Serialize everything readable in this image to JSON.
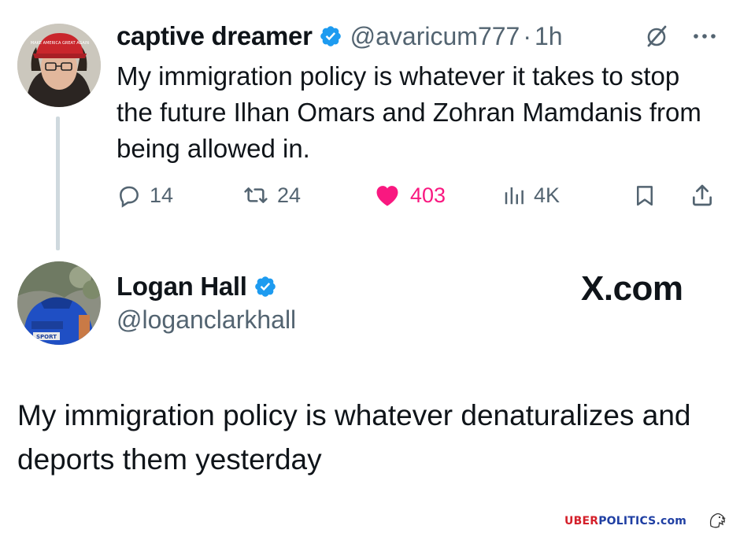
{
  "tweet1": {
    "name": "captive dreamer",
    "handle": "@avaricum777",
    "separator": "·",
    "time": "1h",
    "text": "My immigration policy is whatever it takes to stop the future Ilhan Omars and Zohran Mamdanis from being allowed in.",
    "replies": "14",
    "retweets": "24",
    "likes": "403",
    "views": "4K",
    "avatar_hat_text": "MAKE AMERICA GREAT AGAIN"
  },
  "tweet2": {
    "name": "Logan Hall",
    "handle": "@loganclarkhall",
    "text": "My immigration policy is whatever denaturalizes and deports them yesterday",
    "avatar_jacket_text": "SPORT"
  },
  "brand": {
    "site": "X.com"
  },
  "watermark": {
    "part_a": "UBER",
    "part_b": "POLITICS.com"
  },
  "colors": {
    "text": "#0f1419",
    "muted": "#536471",
    "verified": "#1d9bf0",
    "like": "#f91880",
    "thread_line": "#cfd9de"
  },
  "icons": [
    "grok-icon",
    "more-icon",
    "verified-badge-icon",
    "reply-icon",
    "retweet-icon",
    "heart-icon",
    "views-icon",
    "bookmark-icon",
    "share-icon",
    "eagle-icon"
  ]
}
